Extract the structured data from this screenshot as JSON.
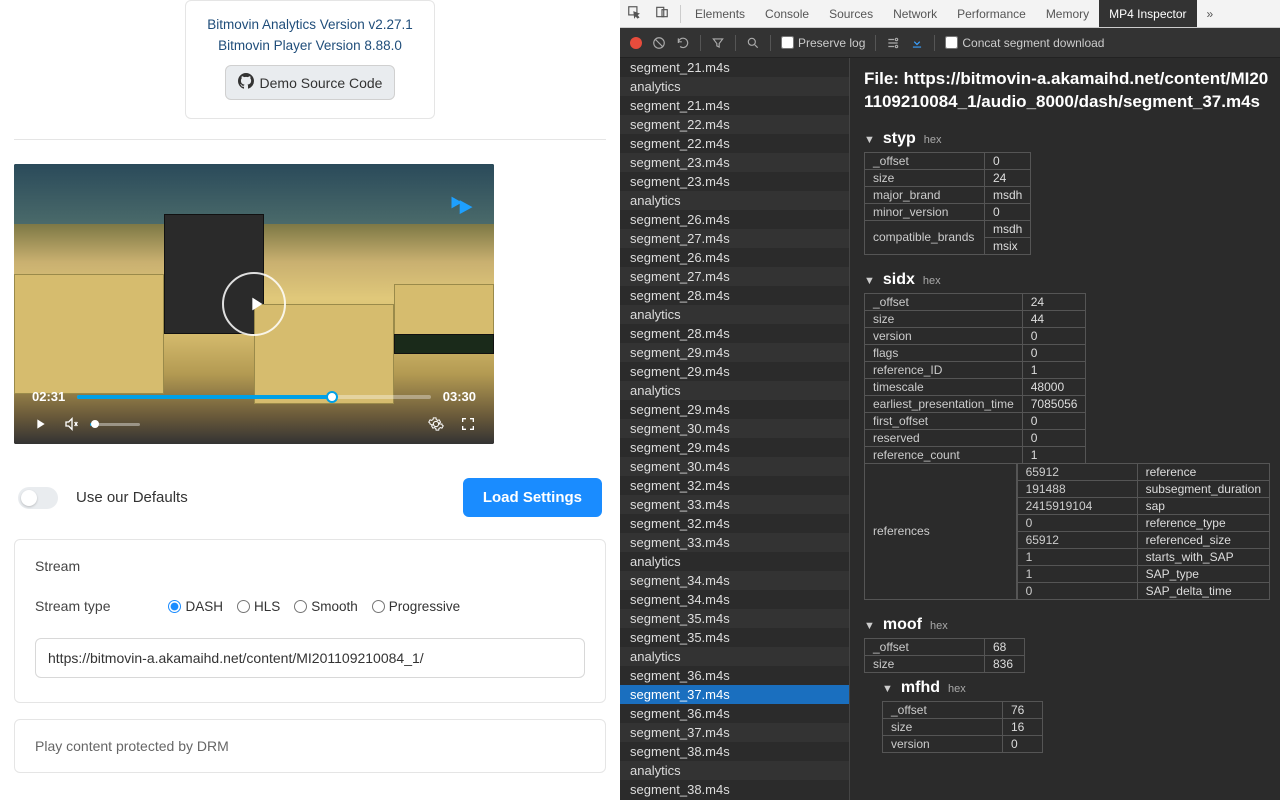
{
  "versionCard": {
    "analytics": "Bitmovin Analytics Version v2.27.1",
    "player": "Bitmovin Player Version 8.88.0",
    "demoBtn": "Demo Source Code"
  },
  "player": {
    "current": "02:31",
    "duration": "03:30"
  },
  "settings": {
    "defaultsLabel": "Use our Defaults",
    "loadBtn": "Load Settings",
    "streamHeading": "Stream",
    "streamTypeLabel": "Stream type",
    "types": {
      "dash": "DASH",
      "hls": "HLS",
      "smooth": "Smooth",
      "progressive": "Progressive"
    },
    "url": "https://bitmovin-a.akamaihd.net/content/MI201109210084_1/",
    "drmHeading": "Play content protected by DRM"
  },
  "devtools": {
    "tabs": [
      "Elements",
      "Console",
      "Sources",
      "Network",
      "Performance",
      "Memory",
      "MP4 Inspector"
    ],
    "activeTab": "MP4 Inspector",
    "preserve": "Preserve log",
    "concat": "Concat segment download"
  },
  "segmentList": [
    "segment_21.m4s",
    "analytics",
    "segment_21.m4s",
    "segment_22.m4s",
    "segment_22.m4s",
    "segment_23.m4s",
    "segment_23.m4s",
    "analytics",
    "segment_26.m4s",
    "segment_27.m4s",
    "segment_26.m4s",
    "segment_27.m4s",
    "segment_28.m4s",
    "analytics",
    "segment_28.m4s",
    "segment_29.m4s",
    "segment_29.m4s",
    "analytics",
    "segment_29.m4s",
    "segment_30.m4s",
    "segment_29.m4s",
    "segment_30.m4s",
    "segment_32.m4s",
    "segment_33.m4s",
    "segment_32.m4s",
    "segment_33.m4s",
    "analytics",
    "segment_34.m4s",
    "segment_34.m4s",
    "segment_35.m4s",
    "segment_35.m4s",
    "analytics",
    "segment_36.m4s",
    "segment_37.m4s",
    "segment_36.m4s",
    "segment_37.m4s",
    "segment_38.m4s",
    "analytics",
    "segment_38.m4s"
  ],
  "selectedSegmentIndex": 33,
  "fileHeader": "File: https://bitmovin-a.akamaihd.net/content/MI201109210084_1/audio_8000/dash/segment_37.m4s",
  "hexLabel": "hex",
  "boxes": {
    "styp": {
      "rows": [
        [
          "_offset",
          "0"
        ],
        [
          "size",
          "24"
        ],
        [
          "major_brand",
          "msdh"
        ],
        [
          "minor_version",
          "0"
        ]
      ],
      "compat": {
        "label": "compatible_brands",
        "values": [
          "msdh",
          "msix"
        ]
      }
    },
    "sidx": {
      "rows": [
        [
          "_offset",
          "24"
        ],
        [
          "size",
          "44"
        ],
        [
          "version",
          "0"
        ],
        [
          "flags",
          "0"
        ],
        [
          "reference_ID",
          "1"
        ],
        [
          "timescale",
          "48000"
        ],
        [
          "earliest_presentation_time",
          "7085056"
        ],
        [
          "first_offset",
          "0"
        ],
        [
          "reserved",
          "0"
        ],
        [
          "reference_count",
          "1"
        ]
      ],
      "referencesLabel": "references",
      "refRows": [
        [
          "65912",
          "reference"
        ],
        [
          "191488",
          "subsegment_duration"
        ],
        [
          "2415919104",
          "sap"
        ],
        [
          "0",
          "reference_type"
        ],
        [
          "65912",
          "referenced_size"
        ],
        [
          "1",
          "starts_with_SAP"
        ],
        [
          "1",
          "SAP_type"
        ],
        [
          "0",
          "SAP_delta_time"
        ]
      ]
    },
    "moof": {
      "rows": [
        [
          "_offset",
          "68"
        ],
        [
          "size",
          "836"
        ]
      ]
    },
    "mfhd": {
      "rows": [
        [
          "_offset",
          "76"
        ],
        [
          "size",
          "16"
        ],
        [
          "version",
          "0"
        ]
      ]
    }
  }
}
